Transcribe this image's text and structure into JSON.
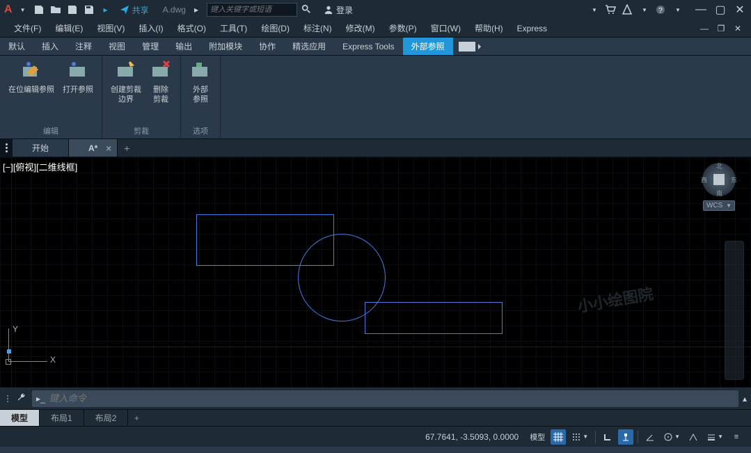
{
  "titleBar": {
    "share": "共享",
    "docName": "A.dwg",
    "searchPlaceholder": "键入关键字或短语",
    "login": "登录"
  },
  "menu": {
    "file": "文件(F)",
    "edit": "编辑(E)",
    "view": "视图(V)",
    "insert": "插入(I)",
    "format": "格式(O)",
    "tools": "工具(T)",
    "draw": "绘图(D)",
    "annotate": "标注(N)",
    "modify": "修改(M)",
    "params": "参数(P)",
    "window": "窗口(W)",
    "help": "帮助(H)",
    "express": "Express"
  },
  "ribbonTabs": {
    "default": "默认",
    "insert": "插入",
    "annotate": "注释",
    "view": "视图",
    "manage": "管理",
    "output": "输出",
    "addon": "附加模块",
    "collab": "协作",
    "apps": "精选应用",
    "expresstools": "Express Tools",
    "xref": "外部参照"
  },
  "ribbon": {
    "editInPlace": "在位编辑参照",
    "openRef": "打开参照",
    "createClip1": "创建剪裁",
    "createClip2": "边界",
    "deleteClip1": "删除",
    "deleteClip2": "剪裁",
    "xrefOpt1": "外部",
    "xrefOpt2": "参照",
    "groupEdit": "编辑",
    "groupClip": "剪裁",
    "groupOption": "选项"
  },
  "docTabs": {
    "start": "开始",
    "active": "A*"
  },
  "canvas": {
    "viewportLabel": "[−][俯视][二维线框]",
    "wcs": "WCS",
    "yLabel": "Y",
    "xLabel": "X",
    "dirN": "北",
    "dirS": "南",
    "dirE": "东",
    "dirW": "西",
    "watermark": "小小绘图院"
  },
  "cmd": {
    "placeholder": "键入命令"
  },
  "layout": {
    "model": "模型",
    "l1": "布局1",
    "l2": "布局2"
  },
  "status": {
    "coords": "67.7641, -3.5093, 0.0000",
    "modelBtn": "模型"
  }
}
